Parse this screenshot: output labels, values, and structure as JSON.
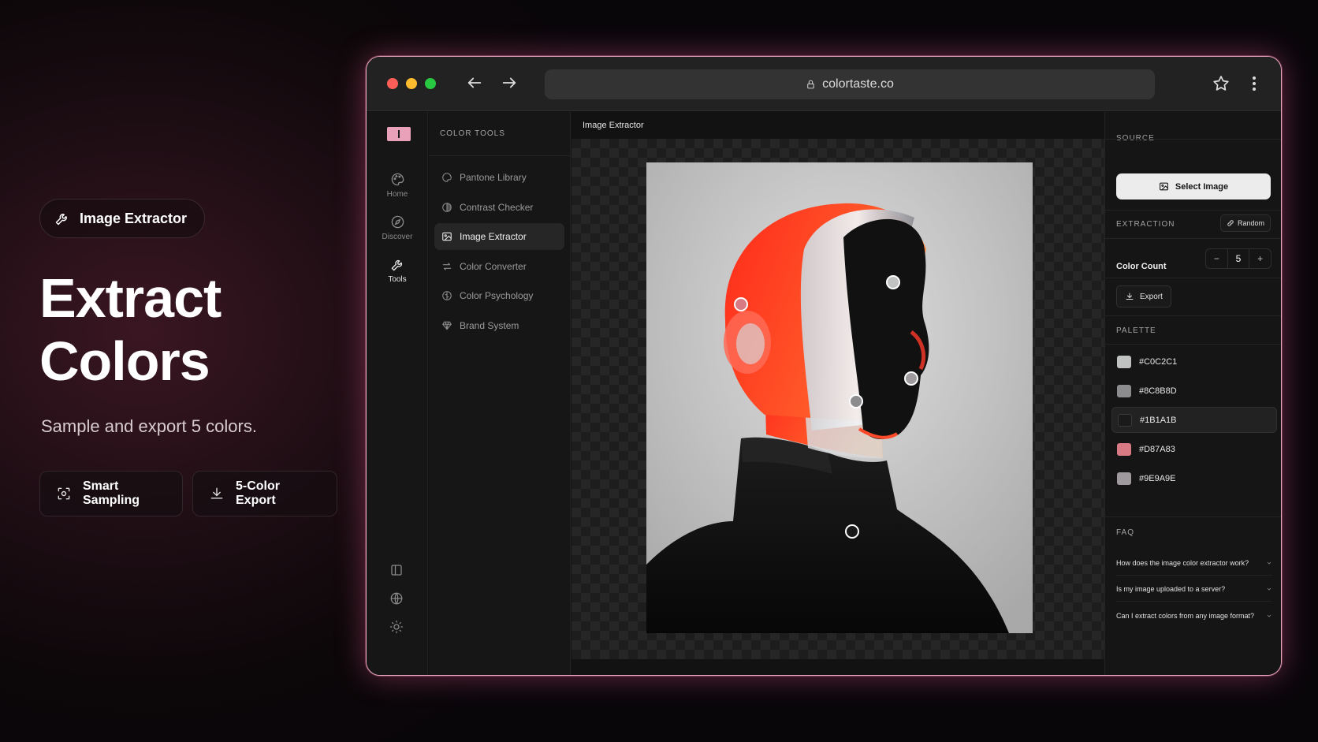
{
  "hero": {
    "chip_label": "Image Extractor",
    "title_line1": "Extract",
    "title_line2": "Colors",
    "subtitle": "Sample and export 5 colors.",
    "features": [
      {
        "label": "Smart Sampling",
        "icon": "scan-icon"
      },
      {
        "label": "5-Color Export",
        "icon": "download-icon"
      }
    ]
  },
  "browser": {
    "url": "colortaste.co",
    "traffic_colors": [
      "#ff5f57",
      "#febc2e",
      "#28c840"
    ]
  },
  "rail": {
    "items": [
      {
        "label": "Home",
        "icon": "palette-icon"
      },
      {
        "label": "Discover",
        "icon": "compass-icon"
      },
      {
        "label": "Tools",
        "icon": "wrench-icon"
      }
    ],
    "bottom_icons": [
      "sidebar-toggle-icon",
      "globe-icon",
      "sun-icon"
    ]
  },
  "tools": {
    "heading": "COLOR TOOLS",
    "items": [
      {
        "label": "Pantone Library",
        "icon": "palette-icon"
      },
      {
        "label": "Contrast Checker",
        "icon": "contrast-icon"
      },
      {
        "label": "Image Extractor",
        "icon": "image-icon"
      },
      {
        "label": "Color Converter",
        "icon": "arrows-swap-icon"
      },
      {
        "label": "Color Psychology",
        "icon": "brain-icon"
      },
      {
        "label": "Brand System",
        "icon": "gem-icon"
      }
    ],
    "active_index": 2
  },
  "main": {
    "heading": "Image Extractor"
  },
  "panel": {
    "source_label": "SOURCE",
    "select_image_label": "Select Image",
    "extraction_label": "EXTRACTION",
    "random_label": "Random",
    "color_count_label": "Color Count",
    "color_count_value": "5",
    "minus": "−",
    "plus": "+",
    "export_label": "Export",
    "palette_label": "PALETTE",
    "palette": [
      {
        "hex": "#C0C2C1",
        "color": "#c0c2c1"
      },
      {
        "hex": "#8C8B8D",
        "color": "#8c8b8d"
      },
      {
        "hex": "#1B1A1B",
        "color": "#1b1a1b"
      },
      {
        "hex": "#D87A83",
        "color": "#d87a83"
      },
      {
        "hex": "#9E9A9E",
        "color": "#9e9a9e"
      }
    ],
    "palette_active_index": 2,
    "faq_label": "FAQ",
    "faq": [
      "How does the image color extractor work?",
      "Is my image uploaded to a server?",
      "Can I extract colors from any image format?"
    ]
  },
  "accent_color": "#e8a1b8"
}
